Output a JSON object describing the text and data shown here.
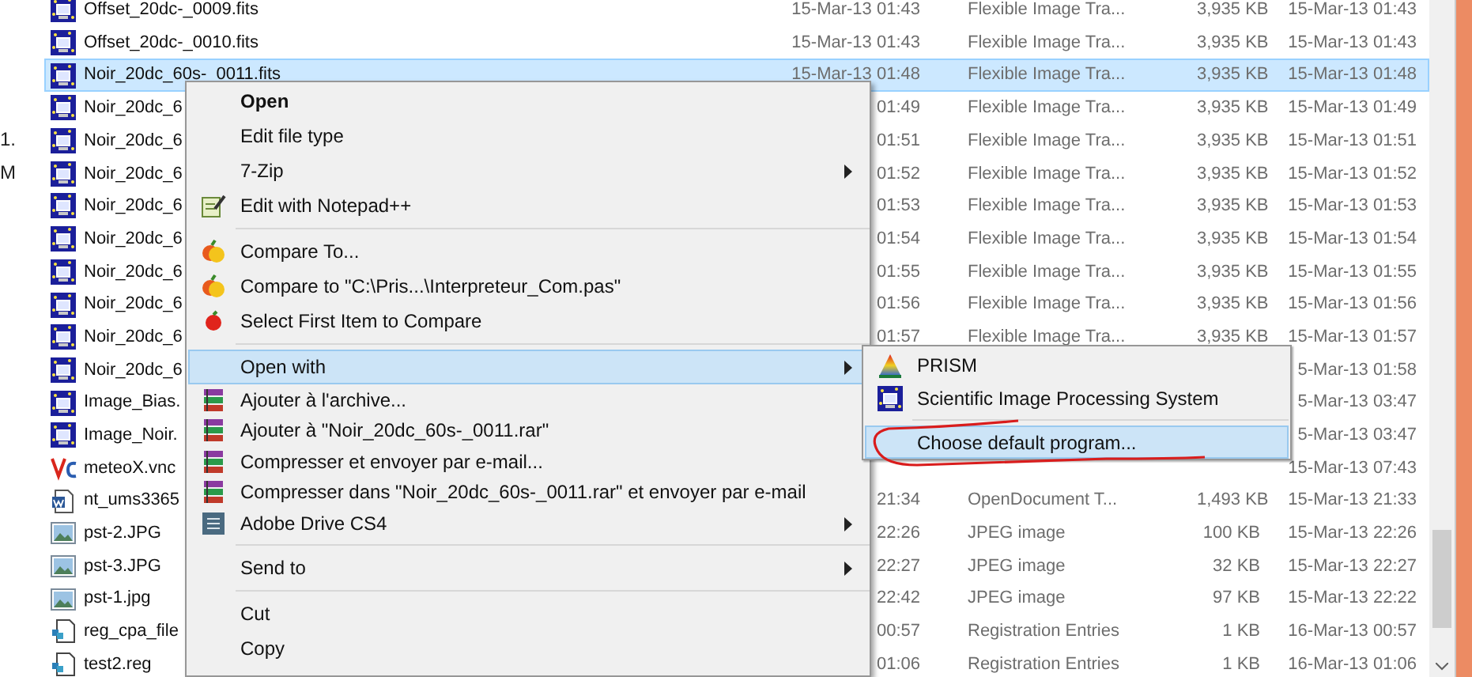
{
  "navigation_pane": {
    "items": [
      "1.",
      "M"
    ]
  },
  "files": [
    {
      "kind": "fits",
      "name": "Offset_20dc-_0009.fits",
      "date_modified": "15-Mar-13 01:43",
      "type": "Flexible Image Tra...",
      "size": "3,935 KB",
      "date_created": "15-Mar-13 01:43",
      "selected": false
    },
    {
      "kind": "fits",
      "name": "Offset_20dc-_0010.fits",
      "date_modified": "15-Mar-13 01:43",
      "type": "Flexible Image Tra...",
      "size": "3,935 KB",
      "date_created": "15-Mar-13 01:43",
      "selected": false
    },
    {
      "kind": "fits",
      "name": "Noir_20dc_60s-_0011.fits",
      "date_modified": "15-Mar-13 01:48",
      "type": "Flexible Image Tra...",
      "size": "3,935 KB",
      "date_created": "15-Mar-13 01:48",
      "selected": true
    },
    {
      "kind": "fits",
      "name": "Noir_20dc_6",
      "date_modified": "01:49",
      "type": "Flexible Image Tra...",
      "size": "3,935 KB",
      "date_created": "15-Mar-13 01:49",
      "selected": false
    },
    {
      "kind": "fits",
      "name": "Noir_20dc_6",
      "date_modified": "01:51",
      "type": "Flexible Image Tra...",
      "size": "3,935 KB",
      "date_created": "15-Mar-13 01:51",
      "selected": false
    },
    {
      "kind": "fits",
      "name": "Noir_20dc_6",
      "date_modified": "01:52",
      "type": "Flexible Image Tra...",
      "size": "3,935 KB",
      "date_created": "15-Mar-13 01:52",
      "selected": false
    },
    {
      "kind": "fits",
      "name": "Noir_20dc_6",
      "date_modified": "01:53",
      "type": "Flexible Image Tra...",
      "size": "3,935 KB",
      "date_created": "15-Mar-13 01:53",
      "selected": false
    },
    {
      "kind": "fits",
      "name": "Noir_20dc_6",
      "date_modified": "01:54",
      "type": "Flexible Image Tra...",
      "size": "3,935 KB",
      "date_created": "15-Mar-13 01:54",
      "selected": false
    },
    {
      "kind": "fits",
      "name": "Noir_20dc_6",
      "date_modified": "01:55",
      "type": "Flexible Image Tra...",
      "size": "3,935 KB",
      "date_created": "15-Mar-13 01:55",
      "selected": false
    },
    {
      "kind": "fits",
      "name": "Noir_20dc_6",
      "date_modified": "01:56",
      "type": "Flexible Image Tra...",
      "size": "3,935 KB",
      "date_created": "15-Mar-13 01:56",
      "selected": false
    },
    {
      "kind": "fits",
      "name": "Noir_20dc_6",
      "date_modified": "01:57",
      "type": "Flexible Image Tra...",
      "size": "3,935 KB",
      "date_created": "15-Mar-13 01:57",
      "selected": false
    },
    {
      "kind": "fits",
      "name": "Noir_20dc_6",
      "date_created": "5-Mar-13 01:58",
      "selected": false
    },
    {
      "kind": "fits",
      "name": "Image_Bias.",
      "date_created": "5-Mar-13 03:47",
      "selected": false
    },
    {
      "kind": "fits",
      "name": "Image_Noir.",
      "date_created": "5-Mar-13 03:47",
      "selected": false
    },
    {
      "kind": "vnc",
      "name": "meteoX.vnc",
      "date_created": "15-Mar-13 07:43",
      "selected": false
    },
    {
      "kind": "doc",
      "name": "nt_ums3365",
      "date_modified": "21:34",
      "type": "OpenDocument T...",
      "size": "1,493 KB",
      "date_created": "15-Mar-13 21:33",
      "selected": false
    },
    {
      "kind": "image",
      "name": "pst-2.JPG",
      "date_modified": "22:26",
      "type": "JPEG image",
      "size": "100 KB",
      "date_created": "15-Mar-13 22:26",
      "selected": false
    },
    {
      "kind": "image",
      "name": "pst-3.JPG",
      "date_modified": "22:27",
      "type": "JPEG image",
      "size": "32 KB",
      "date_created": "15-Mar-13 22:27",
      "selected": false
    },
    {
      "kind": "image",
      "name": "pst-1.jpg",
      "date_modified": "22:42",
      "type": "JPEG image",
      "size": "97 KB",
      "date_created": "15-Mar-13 22:22",
      "selected": false
    },
    {
      "kind": "reg",
      "name": "reg_cpa_file",
      "date_modified": "00:57",
      "type": "Registration Entries",
      "size": "1 KB",
      "date_created": "16-Mar-13 00:57",
      "selected": false
    },
    {
      "kind": "reg",
      "name": "test2.reg",
      "date_modified": "01:06",
      "type": "Registration Entries",
      "size": "1 KB",
      "date_created": "16-Mar-13 01:06",
      "selected": false
    }
  ],
  "context_menu": {
    "items": [
      {
        "kind": "plain",
        "label": "Open",
        "bold": true,
        "submenu": false,
        "selected": false
      },
      {
        "kind": "plain",
        "label": "Edit file type",
        "bold": false,
        "submenu": false,
        "selected": false
      },
      {
        "kind": "plain",
        "label": "7-Zip",
        "bold": false,
        "submenu": true,
        "selected": false
      },
      {
        "kind": "notepad",
        "label": "Edit with Notepad++",
        "bold": false,
        "submenu": false,
        "selected": false
      },
      {
        "kind": "separator"
      },
      {
        "kind": "compare",
        "label": "Compare To...",
        "bold": false,
        "submenu": false,
        "selected": false
      },
      {
        "kind": "compare",
        "label": "Compare to \"C:\\Pris...\\Interpreteur_Com.pas\"",
        "bold": false,
        "submenu": false,
        "selected": false
      },
      {
        "kind": "compare-first",
        "label": "Select First Item to Compare",
        "bold": false,
        "submenu": false,
        "selected": false
      },
      {
        "kind": "separator"
      },
      {
        "kind": "plain",
        "label": "Open with",
        "bold": false,
        "submenu": true,
        "selected": true
      },
      {
        "kind": "archive",
        "label": "Ajouter à l'archive...",
        "bold": false,
        "submenu": false,
        "selected": false
      },
      {
        "kind": "archive",
        "label": "Ajouter à \"Noir_20dc_60s-_0011.rar\"",
        "bold": false,
        "submenu": false,
        "selected": false
      },
      {
        "kind": "archive",
        "label": "Compresser et envoyer par e-mail...",
        "bold": false,
        "submenu": false,
        "selected": false
      },
      {
        "kind": "archive",
        "label": "Compresser dans \"Noir_20dc_60s-_0011.rar\" et envoyer par e-mail",
        "bold": false,
        "submenu": false,
        "selected": false
      },
      {
        "kind": "drive",
        "label": "Adobe Drive CS4",
        "bold": false,
        "submenu": true,
        "selected": false
      },
      {
        "kind": "separator"
      },
      {
        "kind": "plain",
        "label": "Send to",
        "bold": false,
        "submenu": true,
        "selected": false
      },
      {
        "kind": "separator"
      },
      {
        "kind": "plain",
        "label": "Cut",
        "bold": false,
        "submenu": false,
        "selected": false
      },
      {
        "kind": "plain",
        "label": "Copy",
        "bold": false,
        "submenu": false,
        "selected": false
      }
    ]
  },
  "open_with_menu": {
    "items": [
      {
        "kind": "prism",
        "label": "PRISM",
        "selected": false
      },
      {
        "kind": "fits",
        "label": "Scientific Image Processing System",
        "selected": false
      },
      {
        "kind": "separator"
      },
      {
        "kind": "plain",
        "label": "Choose default program...",
        "selected": true
      }
    ]
  }
}
